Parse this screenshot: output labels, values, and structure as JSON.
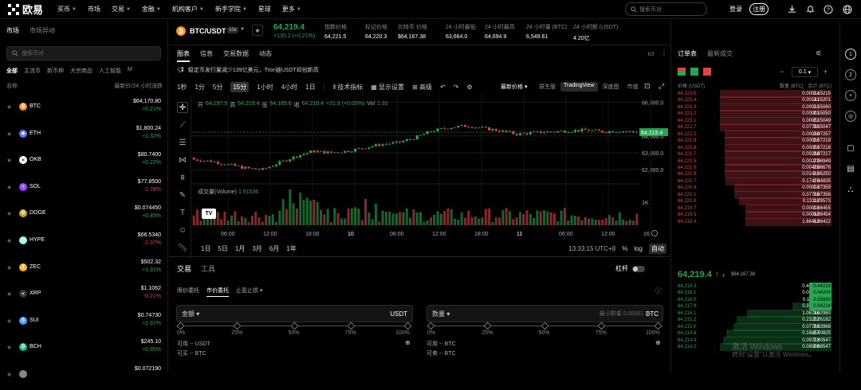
{
  "nav": {
    "items": [
      "买币",
      "市场",
      "交易",
      "金融",
      "机构客户",
      "新手学院",
      "星球",
      "更多"
    ],
    "search_placeholder": "搜索币对",
    "login": "登录",
    "register": "注册"
  },
  "left": {
    "tabs": [
      "市场",
      "市场异动"
    ],
    "search_placeholder": "搜索币对",
    "categories": [
      "全部",
      "主流币",
      "新币种",
      "大宗商品",
      "人工智能",
      "M"
    ],
    "col_name": "名称",
    "col_price": "最新价/24 小时涨跌",
    "coins": [
      {
        "sym": "BTC",
        "price": "$64,170.80",
        "chg": "+0.21%",
        "up": true,
        "color": "#f7931a",
        "glyph": "₿"
      },
      {
        "sym": "ETH",
        "price": "$1,800.24",
        "chg": "+1.32%",
        "up": true,
        "color": "#627eea",
        "glyph": "◆"
      },
      {
        "sym": "OKB",
        "price": "$80.7400",
        "chg": "+0.22%",
        "up": true,
        "color": "#ffffff",
        "glyph": "✕"
      },
      {
        "sym": "SOL",
        "price": "$77.8500",
        "chg": "-1.78%",
        "up": false,
        "color": "#9945ff",
        "glyph": "≡"
      },
      {
        "sym": "DOGE",
        "price": "$0.074450",
        "chg": "+0.45%",
        "up": true,
        "color": "#c2a633",
        "glyph": "Ð"
      },
      {
        "sym": "HYPE",
        "price": "$66.5340",
        "chg": "-2.37%",
        "up": false,
        "color": "#97fce4",
        "glyph": "∞"
      },
      {
        "sym": "ZEC",
        "price": "$502.32",
        "chg": "+1.91%",
        "up": true,
        "color": "#f4b728",
        "glyph": "Z"
      },
      {
        "sym": "XRP",
        "price": "$1.1062",
        "chg": "-0.21%",
        "up": false,
        "color": "#333333",
        "glyph": "✕"
      },
      {
        "sym": "SUI",
        "price": "$0.74730",
        "chg": "+2.91%",
        "up": true,
        "color": "#4da2ff",
        "glyph": "S"
      },
      {
        "sym": "BCH",
        "price": "$245.10",
        "chg": "+0.95%",
        "up": true,
        "color": "#0ac18e",
        "glyph": "₿"
      },
      {
        "sym": "",
        "price": "$0.072190",
        "chg": "",
        "up": true,
        "color": "#888888",
        "glyph": ""
      }
    ]
  },
  "ticker": {
    "pair": "BTC/USDT",
    "leverage": "10x",
    "last": "64,219.4",
    "change": "+135.2 (+0.21%)",
    "stats": [
      {
        "k": "指数价格",
        "v": "64,221.5"
      },
      {
        "k": "标记价格",
        "v": "64,220.3"
      },
      {
        "k": "比特币 价格",
        "v": "$64,167.38"
      },
      {
        "k": "24 小时最低",
        "v": "63,664.0"
      },
      {
        "k": "24 小时最高",
        "v": "64,694.9"
      },
      {
        "k": "24 小时量 (BTC)",
        "v": "6,549.61"
      },
      {
        "k": "24 小时额 (USDT)",
        "v": "4.20亿"
      }
    ]
  },
  "chart_panel": {
    "tabs": [
      "图表",
      "信息",
      "交易数据",
      "动态"
    ],
    "notice": "稳定币发行量减少139亿美元，Tron链USDT却创新高",
    "timeframes": [
      "1秒",
      "1分",
      "5分",
      "15分",
      "1小时",
      "4小时",
      "1日"
    ],
    "active_tf": "15分",
    "tools": [
      "技术指标",
      "显示设置",
      "高级"
    ],
    "price_type": "最新价格",
    "view_modes": [
      "原生版",
      "TradingView",
      "深度图",
      "市值"
    ],
    "ohlc": {
      "open_l": "开",
      "open": "64,197.5",
      "high_l": "高",
      "high": "64,219.4",
      "low_l": "低",
      "low": "64,165.6",
      "close_l": "收",
      "close": "64,219.4",
      "chg": "+21.9 (+0.03%)",
      "vol_l": "Vol",
      "vol": "1.92"
    },
    "volume_label": "成交量(Volume)",
    "volume_value": "1.91536",
    "y_ticks": [
      "66,000.0",
      "64,000.0",
      "63,000.0",
      "62,000.0"
    ],
    "last_tag": "64,219.4",
    "vol_tick": "1K",
    "x_ticks": [
      "06:00",
      "12:00",
      "18:00",
      "10",
      "06:00",
      "12:00",
      "18:00",
      "11",
      "06:00",
      "12:00",
      "16:"
    ],
    "ranges": [
      "1日",
      "5日",
      "1月",
      "3月",
      "6月",
      "1年"
    ],
    "time": "13:33:15 UTC+8",
    "pct": "%",
    "log": "log",
    "auto": "自动"
  },
  "order": {
    "tabs": [
      "交易",
      "工具"
    ],
    "leverage_label": "杠杆",
    "types": [
      "限价委托",
      "市价委托",
      "止盈止损"
    ],
    "amount_label": "金额",
    "amount_unit": "USDT",
    "qty_label": "数量",
    "qty_placeholder": "最小数量 0.00001",
    "qty_unit": "BTC",
    "ticks": [
      "0%",
      "25%",
      "50%",
      "75%",
      "100%"
    ],
    "avail_usdt": "可用 -- USDT",
    "buy_btc": "可买 -- BTC",
    "avail_btc": "可用 -- BTC",
    "sell_btc": "可卖 -- BTC"
  },
  "book": {
    "tabs": [
      "订单表",
      "最新成交"
    ],
    "step": "0.1",
    "col_price": "价格 (USDT)",
    "col_qty": "数量 (BTC)",
    "col_total": "合计 (BTC)",
    "asks": [
      {
        "p": "64,223.5",
        "q": "0.00014",
        "t": "2.15215",
        "f": 1.0
      },
      {
        "p": "64,223.4",
        "q": "0.00141",
        "t": "2.15201",
        "f": 1.0
      },
      {
        "p": "64,223.3",
        "q": "0.00010",
        "t": "2.15060",
        "f": 1.0
      },
      {
        "p": "64,223.2",
        "q": "0.00001",
        "t": "2.15050",
        "f": 1.0
      },
      {
        "p": "64,223.1",
        "q": "0.00002",
        "t": "2.15049",
        "f": 1.0
      },
      {
        "p": "64,222.7",
        "q": "0.07790",
        "t": "2.15047",
        "f": 1.0
      },
      {
        "p": "64,222.2",
        "q": "0.00038",
        "t": "2.07257",
        "f": 0.96
      },
      {
        "p": "64,221.9",
        "q": "0.00001",
        "t": "2.07219",
        "f": 0.96
      },
      {
        "p": "64,221.8",
        "q": "0.00001",
        "t": "2.07218",
        "f": 0.96
      },
      {
        "p": "64,221.7",
        "q": "0.00268",
        "t": "2.07217",
        "f": 0.96
      },
      {
        "p": "64,221.5",
        "q": "0.00273",
        "t": "2.06949",
        "f": 0.96
      },
      {
        "p": "64,221.0",
        "q": "0.00426",
        "t": "2.06676",
        "f": 0.96
      },
      {
        "p": "64,220.9",
        "q": "0.01415",
        "t": "2.06250",
        "f": 0.96
      },
      {
        "p": "64,220.7",
        "q": "0.17476",
        "t": "2.04835",
        "f": 0.95
      },
      {
        "p": "64,220.4",
        "q": "0.00001",
        "t": "1.87359",
        "f": 0.87
      },
      {
        "p": "64,220.1",
        "q": "0.07785",
        "t": "1.87358",
        "f": 0.87
      },
      {
        "p": "64,220.0",
        "q": "0.13118",
        "t": "1.79573",
        "f": 0.83
      },
      {
        "p": "64,219.7",
        "q": "0.00001",
        "t": "1.66455",
        "f": 0.77
      },
      {
        "p": "64,219.5",
        "q": "0.00042",
        "t": "1.66454",
        "f": 0.77
      },
      {
        "p": "64,219.4",
        "q": "1.66412",
        "t": "1.66412",
        "f": 0.77
      }
    ],
    "mid": "64,219.4",
    "mid_ref": "$64,167.38",
    "bids": [
      {
        "p": "64,219.3",
        "q": "0.44228",
        "t": "0.44228",
        "f": 0.17
      },
      {
        "p": "64,218.1",
        "q": "0.00015",
        "t": "0.44243",
        "f": 0.17
      },
      {
        "p": "64,218.0",
        "q": "0.11447",
        "t": "0.55690",
        "f": 0.21
      },
      {
        "p": "64,217.9",
        "q": "0.38544",
        "t": "0.94234",
        "f": 0.35
      },
      {
        "p": "64,216.1",
        "q": "1.08746",
        "t": "2.02980",
        "f": 0.76
      },
      {
        "p": "64,215.2",
        "q": "0.23202",
        "t": "2.26182",
        "f": 0.85
      },
      {
        "p": "64,215.0",
        "q": "0.07786",
        "t": "2.33968",
        "f": 0.88
      },
      {
        "p": "64,214.8",
        "q": "0.16857",
        "t": "2.50825",
        "f": 0.94
      },
      {
        "p": "64,214.3",
        "q": "0.09722",
        "t": "2.60547",
        "f": 0.97
      },
      {
        "p": "64,214.2",
        "q": "0.08000",
        "t": "2.68547",
        "f": 1.0
      }
    ]
  },
  "watermark": {
    "line1": "激活 Windows",
    "line2": "转到\"设置\"以激活 Windows。"
  },
  "rail": [
    "1",
    "2"
  ]
}
